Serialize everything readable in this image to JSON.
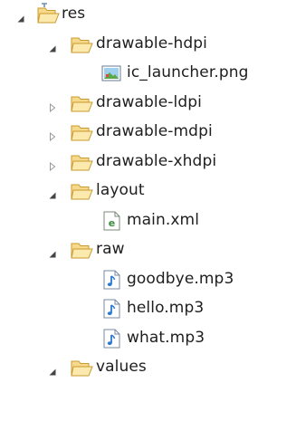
{
  "tree": {
    "items": [
      {
        "label": "res",
        "icon": "res-folder-icon",
        "expander": "expanded",
        "level": 0
      },
      {
        "label": "drawable-hdpi",
        "icon": "folder-icon",
        "expander": "expanded",
        "level": 1
      },
      {
        "label": "ic_launcher.png",
        "icon": "png-file-icon",
        "expander": "none",
        "level": 2
      },
      {
        "label": "drawable-ldpi",
        "icon": "folder-icon",
        "expander": "collapsed",
        "level": 1
      },
      {
        "label": "drawable-mdpi",
        "icon": "folder-icon",
        "expander": "collapsed",
        "level": 1
      },
      {
        "label": "drawable-xhdpi",
        "icon": "folder-icon",
        "expander": "collapsed",
        "level": 1
      },
      {
        "label": "layout",
        "icon": "folder-icon",
        "expander": "expanded",
        "level": 1
      },
      {
        "label": "main.xml",
        "icon": "xml-file-icon",
        "expander": "none",
        "level": 2
      },
      {
        "label": "raw",
        "icon": "folder-icon",
        "expander": "expanded",
        "level": 1
      },
      {
        "label": "goodbye.mp3",
        "icon": "audio-file-icon",
        "expander": "none",
        "level": 2
      },
      {
        "label": "hello.mp3",
        "icon": "audio-file-icon",
        "expander": "none",
        "level": 2
      },
      {
        "label": "what.mp3",
        "icon": "audio-file-icon",
        "expander": "none",
        "level": 2
      },
      {
        "label": "values",
        "icon": "folder-icon",
        "expander": "expanded",
        "level": 1
      }
    ]
  }
}
